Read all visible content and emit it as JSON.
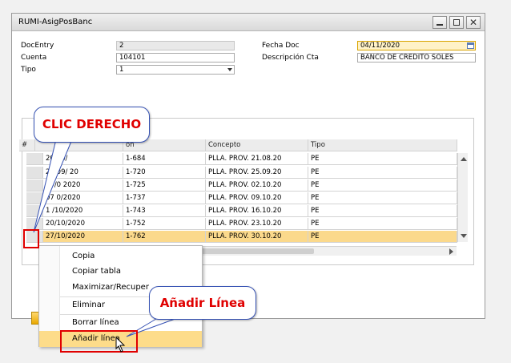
{
  "window": {
    "title": "RUMI-AsigPosBanc"
  },
  "header": {
    "doc_entry_label": "DocEntry",
    "doc_entry_value": "2",
    "cuenta_label": "Cuenta",
    "cuenta_value": "104101",
    "tipo_label": "Tipo",
    "tipo_value": "1",
    "fecha_label": "Fecha Doc",
    "fecha_value": "04/11/2020",
    "desc_label": "Descripción Cta",
    "desc_value": "BANCO DE CRÉDITO SOLES"
  },
  "table": {
    "columns": [
      "#",
      "",
      "ón",
      "Concepto",
      "Tipo"
    ],
    "rows": [
      {
        "date": "20/08/",
        "code": "1-684",
        "concept": "PLLA. PROV. 21.08.20",
        "type": "PE"
      },
      {
        "date": "24/09/ 20",
        "code": "1-720",
        "concept": "PLLA. PROV. 25.09.20",
        "type": "PE"
      },
      {
        "date": "29/0 2020",
        "code": "1-725",
        "concept": "PLLA. PROV. 02.10.20",
        "type": "PE"
      },
      {
        "date": "07 0/2020",
        "code": "1-737",
        "concept": "PLLA. PROV. 09.10.20",
        "type": "PE"
      },
      {
        "date": "1 /10/2020",
        "code": "1-743",
        "concept": "PLLA. PROV. 16.10.20",
        "type": "PE"
      },
      {
        "date": "20/10/2020",
        "code": "1-752",
        "concept": "PLLA. PROV. 23.10.20",
        "type": "PE"
      },
      {
        "date": "27/10/2020",
        "code": "1-762",
        "concept": "PLLA. PROV. 30.10.20",
        "type": "PE"
      }
    ]
  },
  "context_menu": {
    "items": [
      "Copia",
      "Copiar tabla",
      "Maximizar/Recuper",
      "Eliminar",
      "Borrar línea",
      "Añadir línea"
    ],
    "active_item": "Añadir línea"
  },
  "callouts": {
    "right_click": "CLIC DERECHO",
    "add_line": "Añadir Línea"
  },
  "colors": {
    "highlight_row": "#fbd98c",
    "callout_text": "#e00000",
    "callout_border": "#3551b3"
  }
}
